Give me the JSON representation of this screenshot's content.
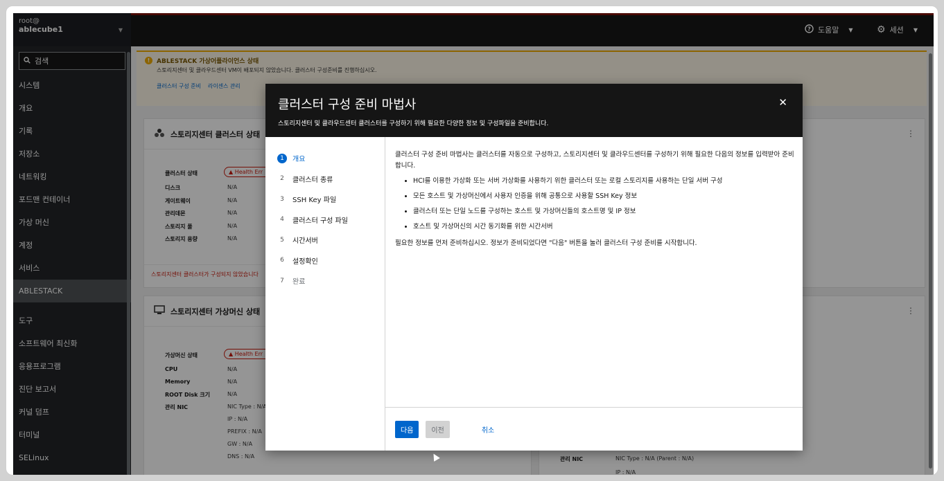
{
  "sidebar": {
    "user": "root@",
    "host": "ablecube1",
    "search_label": "검색",
    "items": [
      {
        "label": "시스템",
        "active": false
      },
      {
        "label": "개요",
        "active": false
      },
      {
        "label": "기록",
        "active": false
      },
      {
        "label": "저장소",
        "active": false
      },
      {
        "label": "네트워킹",
        "active": false
      },
      {
        "label": "포드맨 컨테이너",
        "active": false
      },
      {
        "label": "가상 머신",
        "active": false
      },
      {
        "label": "계정",
        "active": false
      },
      {
        "label": "서비스",
        "active": false
      },
      {
        "label": "ABLESTACK",
        "active": true
      }
    ],
    "tools_items": [
      {
        "label": "도구"
      },
      {
        "label": "소프트웨어 최신화"
      },
      {
        "label": "응용프로그램"
      },
      {
        "label": "진단 보고서"
      },
      {
        "label": "커널 덤프"
      },
      {
        "label": "터미널"
      },
      {
        "label": "SELinux"
      }
    ]
  },
  "topbar": {
    "help_label": "도움말",
    "session_label": "세션"
  },
  "alert": {
    "title": "ABLESTACK 가상어플라이언스 상태",
    "description": "스토리지센터 및 클라우드센터 VM이 배포되지 않았습니다. 클러스터 구성준비를 진행하십시오.",
    "links": [
      "클러스터 구성 준비",
      "라이센스 관리"
    ]
  },
  "storage_card": {
    "title": "스토리지센터 클러스터 상태",
    "status_label": "클러스터 상태",
    "status_value": "Health Err",
    "rows": [
      {
        "k": "디스크",
        "v": "N/A"
      },
      {
        "k": "게이트웨이",
        "v": "N/A"
      },
      {
        "k": "관리데몬",
        "v": "N/A"
      },
      {
        "k": "스토리지 풀",
        "v": "N/A"
      },
      {
        "k": "스토리지 용량",
        "v": "N/A"
      }
    ],
    "footer": "스토리지센터 클러스터가 구성되지 않았습니다"
  },
  "vm_card": {
    "title": "스토리지센터 가상머신 상태",
    "status_label": "가상머신 상태",
    "status_value": "Health Err",
    "rows": [
      {
        "k": "CPU",
        "v": "N/A"
      },
      {
        "k": "Memory",
        "v": "N/A"
      },
      {
        "k": "ROOT Disk 크기",
        "v": "N/A"
      },
      {
        "k": "관리 NIC",
        "v": "NIC Type : N/A"
      },
      {
        "k": "",
        "v": "IP : N/A"
      },
      {
        "k": "",
        "v": "PREFIX : N/A"
      },
      {
        "k": "",
        "v": "GW : N/A"
      },
      {
        "k": "",
        "v": "DNS : N/A"
      }
    ]
  },
  "right_card": {
    "nic_label": "관리 NIC",
    "nic_value": "NIC Type : N/A (Parent : N/A)",
    "ip_value": "IP : N/A"
  },
  "modal": {
    "title": "클러스터 구성 준비 마법사",
    "subtitle": "스토리지센터 및 클라우드센터 클러스터를 구성하기 위해 필요한 다양한 정보 및 구성파일을 준비합니다.",
    "steps": [
      {
        "num": "1",
        "label": "개요",
        "state": "current"
      },
      {
        "num": "2",
        "label": "클러스터 종류",
        "state": "normal"
      },
      {
        "num": "3",
        "label": "SSH Key 파일",
        "state": "normal"
      },
      {
        "num": "4",
        "label": "클러스터 구성 파일",
        "state": "normal"
      },
      {
        "num": "5",
        "label": "시간서버",
        "state": "normal"
      },
      {
        "num": "6",
        "label": "설정확인",
        "state": "normal"
      },
      {
        "num": "7",
        "label": "완료",
        "state": "disabled"
      }
    ],
    "intro": "클러스터 구성 준비 마법사는 클러스터를 자동으로 구성하고, 스토리지센터 및 클라우드센터를 구성하기 위해 필요한 다음의 정보를 입력받아 준비합니다.",
    "bullets": [
      "HCI를 이용한 가상화 또는 서버 가상화를 사용하기 위한 클러스터 또는 로컬 스토리지를 사용하는 단일 서버 구성",
      "모든 호스트 및 가상머신에서 사용자 인증을 위해 공통으로 사용할 SSH Key 정보",
      "클러스터 또는 단일 노드를 구성하는 호스트 및 가상머신들의 호스트명 및 IP 정보",
      "호스트 및 가상머신의 시간 동기화를 위한 시간서버"
    ],
    "outro": "필요한 정보를 먼저 준비하십시오. 정보가 준비되었다면 \"다음\" 버튼을 눌러 클러스터 구성 준비를 시작합니다.",
    "buttons": {
      "next": "다음",
      "prev": "이전",
      "cancel": "취소"
    }
  }
}
